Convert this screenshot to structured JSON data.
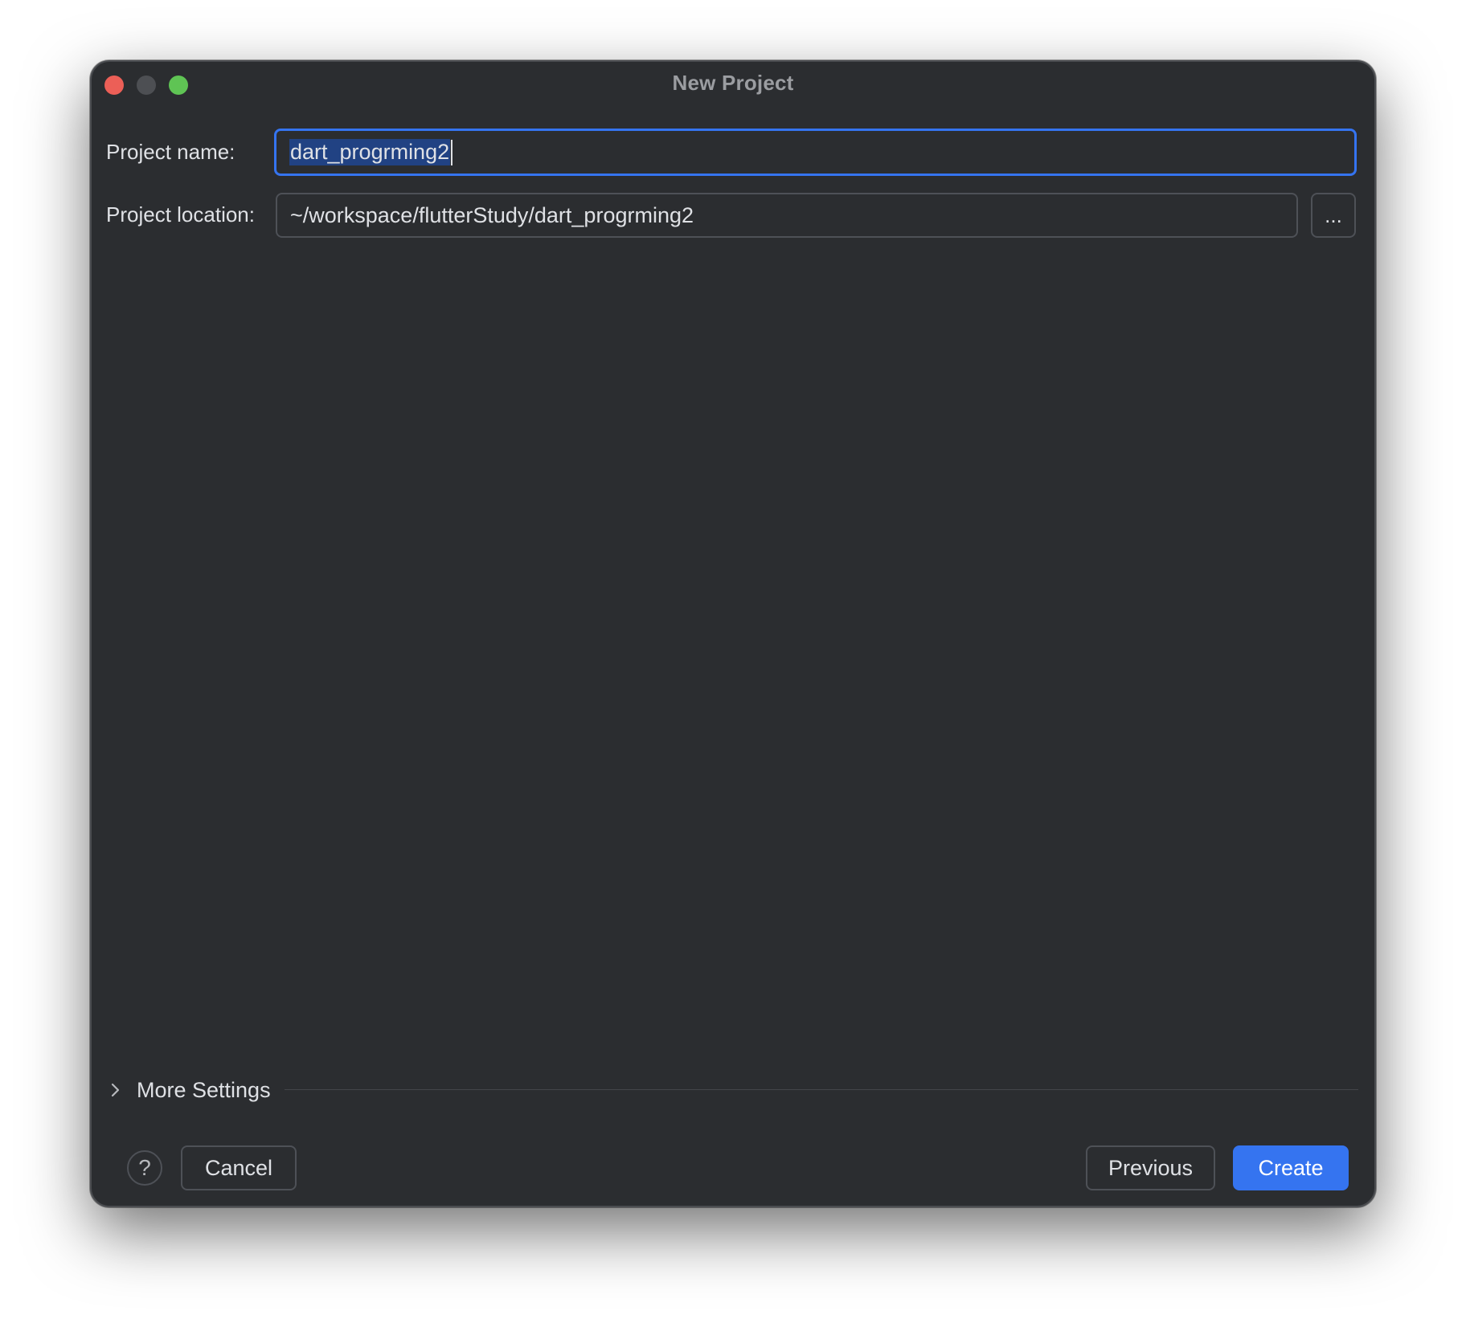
{
  "window": {
    "title": "New Project"
  },
  "form": {
    "project_name_label": "Project name:",
    "project_name_value": "dart_progrming2",
    "project_location_label": "Project location:",
    "project_location_value": "~/workspace/flutterStudy/dart_progrming2",
    "browse_label": "..."
  },
  "more_settings": {
    "label": "More Settings",
    "icon": "chevron-right-icon"
  },
  "footer": {
    "help_label": "?",
    "cancel_label": "Cancel",
    "previous_label": "Previous",
    "create_label": "Create"
  },
  "colors": {
    "background": "#2b2d30",
    "accent": "#3574f0",
    "traffic_close": "#ec5f57",
    "traffic_minimize": "#4d4f53",
    "traffic_zoom": "#5fc454"
  }
}
